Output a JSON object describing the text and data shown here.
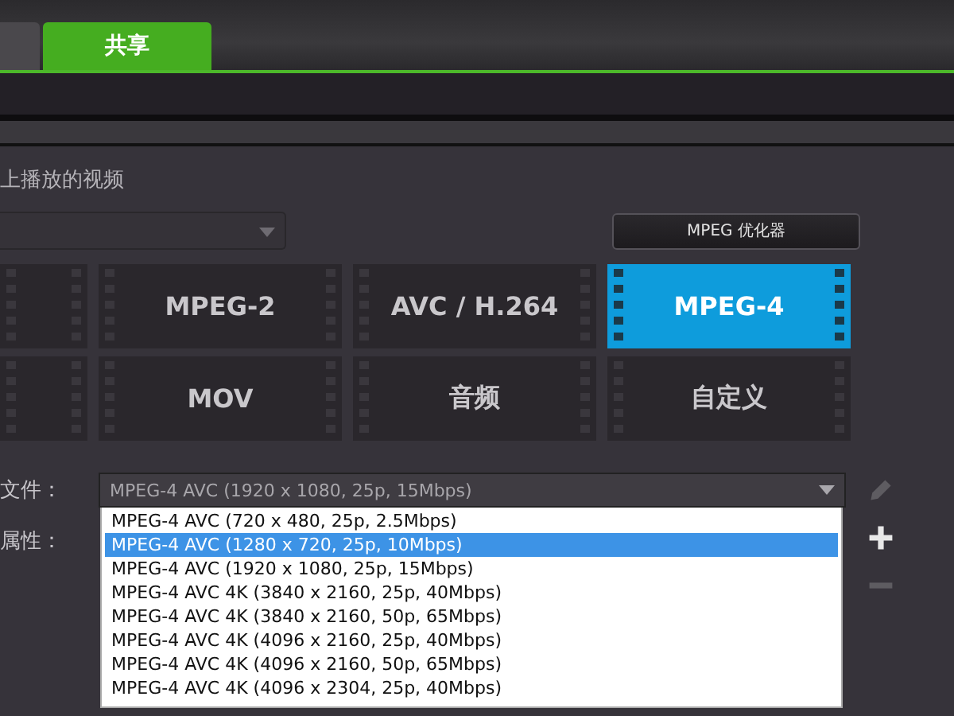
{
  "tabs": [
    {
      "selected": false
    },
    {
      "label": "共享",
      "selected": true
    }
  ],
  "section_title": "上播放的视频",
  "optimizer_button": "MPEG 优化器",
  "format_tiles": [
    {
      "selected": false
    },
    {
      "label": "MPEG-2",
      "selected": false
    },
    {
      "label": "AVC / H.264",
      "selected": false
    },
    {
      "label": "MPEG-4",
      "selected": true
    },
    {
      "selected": false
    },
    {
      "label": "MOV",
      "selected": false
    },
    {
      "label": "音频",
      "selected": false
    },
    {
      "label": "自定义",
      "selected": false
    }
  ],
  "file_label": "文件：",
  "file_select": {
    "value": "MPEG-4 AVC (1920 x 1080, 25p, 15Mbps)",
    "expanded": true
  },
  "properties_label": "属性：",
  "file_options": [
    {
      "label": "MPEG-4 AVC (720 x 480, 25p, 2.5Mbps)",
      "selected": false
    },
    {
      "label": "MPEG-4 AVC (1280 x 720, 25p, 10Mbps)",
      "selected": true
    },
    {
      "label": "MPEG-4 AVC (1920 x 1080, 25p, 15Mbps)",
      "selected": false
    },
    {
      "label": "MPEG-4 AVC 4K (3840 x 2160, 25p, 40Mbps)",
      "selected": false
    },
    {
      "label": "MPEG-4 AVC 4K (3840 x 2160, 50p, 65Mbps)",
      "selected": false
    },
    {
      "label": "MPEG-4 AVC 4K (4096 x 2160, 25p, 40Mbps)",
      "selected": false
    },
    {
      "label": "MPEG-4 AVC 4K (4096 x 2160, 50p, 65Mbps)",
      "selected": false
    },
    {
      "label": "MPEG-4 AVC 4K (4096 x 2304, 25p, 40Mbps)",
      "selected": false
    }
  ],
  "side_tools": [
    {
      "kind": "edit",
      "disabled": true
    },
    {
      "kind": "add",
      "disabled": false
    },
    {
      "kind": "remove",
      "disabled": true
    }
  ]
}
